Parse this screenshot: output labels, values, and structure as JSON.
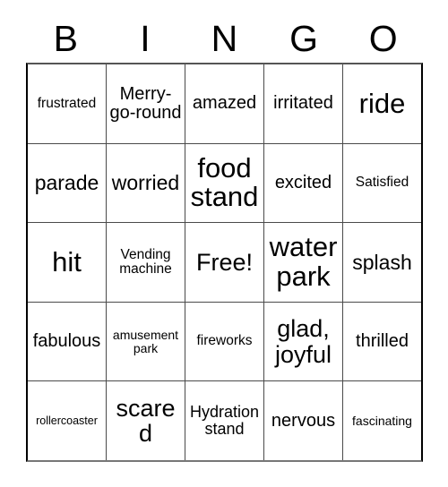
{
  "card": {
    "title": "Bingo Card",
    "background_color": "#ffffff",
    "text_color": "#000000",
    "border_color": "#4a4a4a"
  },
  "header": {
    "letters": [
      "B",
      "I",
      "N",
      "G",
      "O"
    ]
  },
  "grid": {
    "rows": 5,
    "columns": 5,
    "cells": [
      [
        {
          "text": "frustrated",
          "size": "fs-s"
        },
        {
          "text": "Merry-go-round",
          "size": "fs-ml"
        },
        {
          "text": "amazed",
          "size": "fs-ml"
        },
        {
          "text": "irritated",
          "size": "fs-ml"
        },
        {
          "text": "ride",
          "size": "fs-xxl"
        }
      ],
      [
        {
          "text": "parade",
          "size": "fs-l"
        },
        {
          "text": "worried",
          "size": "fs-l"
        },
        {
          "text": "food stand",
          "size": "fs-xxl"
        },
        {
          "text": "excited",
          "size": "fs-ml"
        },
        {
          "text": "Satisfied",
          "size": "fs-s"
        }
      ],
      [
        {
          "text": "hit",
          "size": "fs-xxl"
        },
        {
          "text": "Vending machine",
          "size": "fs-s"
        },
        {
          "text": "Free!",
          "size": "fs-xl"
        },
        {
          "text": "water park",
          "size": "fs-xxl"
        },
        {
          "text": "splash",
          "size": "fs-l"
        }
      ],
      [
        {
          "text": "fabulous",
          "size": "fs-ml"
        },
        {
          "text": "amusement park",
          "size": "fs-xs"
        },
        {
          "text": "fireworks",
          "size": "fs-s"
        },
        {
          "text": "glad, joyful",
          "size": "fs-xl"
        },
        {
          "text": "thrilled",
          "size": "fs-ml"
        }
      ],
      [
        {
          "text": "rollercoaster",
          "size": "fs-xxs"
        },
        {
          "text": "scared",
          "size": "fs-xl"
        },
        {
          "text": "Hydration stand",
          "size": "fs-m"
        },
        {
          "text": "nervous",
          "size": "fs-ml"
        },
        {
          "text": "fascinating",
          "size": "fs-xs"
        }
      ]
    ]
  }
}
